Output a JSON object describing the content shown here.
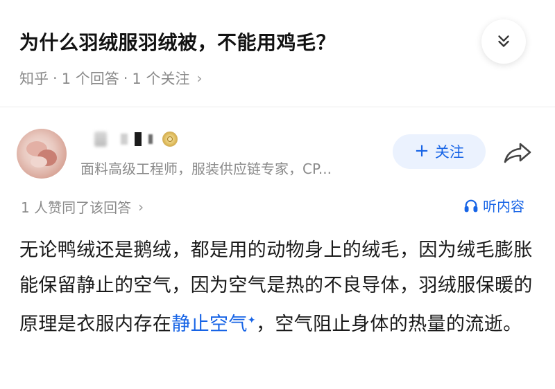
{
  "question": {
    "title": "为什么羽绒服羽绒被，不能用鸡毛？",
    "source": "知乎",
    "answers": "1 个回答",
    "followers": "1 个关注",
    "separator": "·",
    "chevron": "›"
  },
  "author": {
    "bio": "面料高级工程师，服装供应链专家，CP...",
    "follow_label": "关注",
    "follow_plus": "+"
  },
  "answer_meta": {
    "votes": "1 人赞同了该回答",
    "chevron": "›",
    "listen_label": "听内容"
  },
  "answer_body": {
    "text_before": "无论鸭绒还是鹅绒，都是用的动物身上的绒毛，因为绒毛膨胀能保留静止的空气，因为空气是热的不良导体，羽绒服保暖的原理是衣服内存在",
    "link_text": "静止空气",
    "link_mark": "✦",
    "text_after": "，空气阻止身体的热量的流逝。"
  },
  "icons": {
    "collapse": "double-chevron-down-icon",
    "share": "share-arrow-icon",
    "listen": "headphones-icon",
    "badge": "medal-badge-icon"
  },
  "colors": {
    "accent": "#1764e6",
    "follow_bg": "#ebf2fe",
    "meta_text": "#8a8a8a"
  }
}
